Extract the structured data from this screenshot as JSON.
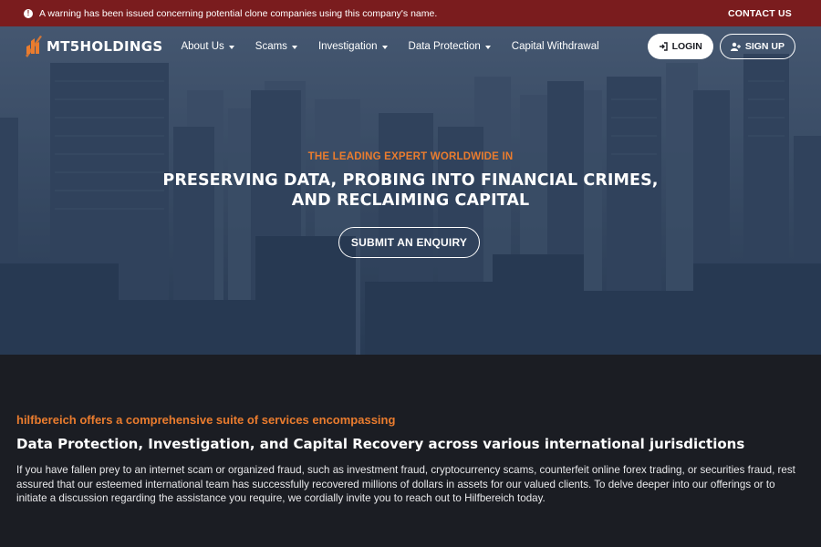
{
  "warning_bar": {
    "message": "A warning has been issued concerning potential clone companies using this company's name.",
    "contact_label": "CONTACT US"
  },
  "brand": {
    "name": "MT5HOLDINGS",
    "accent": "#ea7c2e"
  },
  "nav": {
    "items": [
      {
        "label": "About Us",
        "dropdown": true
      },
      {
        "label": "Scams",
        "dropdown": true
      },
      {
        "label": "Investigation",
        "dropdown": true
      },
      {
        "label": "Data Protection",
        "dropdown": true
      },
      {
        "label": "Capital Withdrawal",
        "dropdown": false
      }
    ],
    "login_label": "LOGIN",
    "signup_label": "SIGN UP"
  },
  "hero": {
    "kicker": "THE LEADING EXPERT WORLDWIDE IN",
    "headline_line1": "PRESERVING DATA, PROBING INTO FINANCIAL CRIMES,",
    "headline_line2": "AND RECLAIMING CAPITAL",
    "cta_label": "SUBMIT AN ENQUIRY"
  },
  "services": {
    "intro": "hilfbereich offers a comprehensive suite of services encompassing",
    "title": "Data Protection, Investigation, and Capital Recovery across various international jurisdictions",
    "body": "If you have fallen prey to an internet scam or organized fraud, such as investment fraud, cryptocurrency scams, counterfeit online forex trading, or securities fraud, rest assured that our esteemed international team has successfully recovered millions of dollars in assets for our valued clients. To delve deeper into our offerings or to initiate a discussion regarding the assistance you require, we cordially invite you to reach out to Hilfbereich today."
  },
  "colors": {
    "warning_bg": "#7a1c1e",
    "accent": "#ea7c2e",
    "dark_bg": "#1b1d23"
  }
}
